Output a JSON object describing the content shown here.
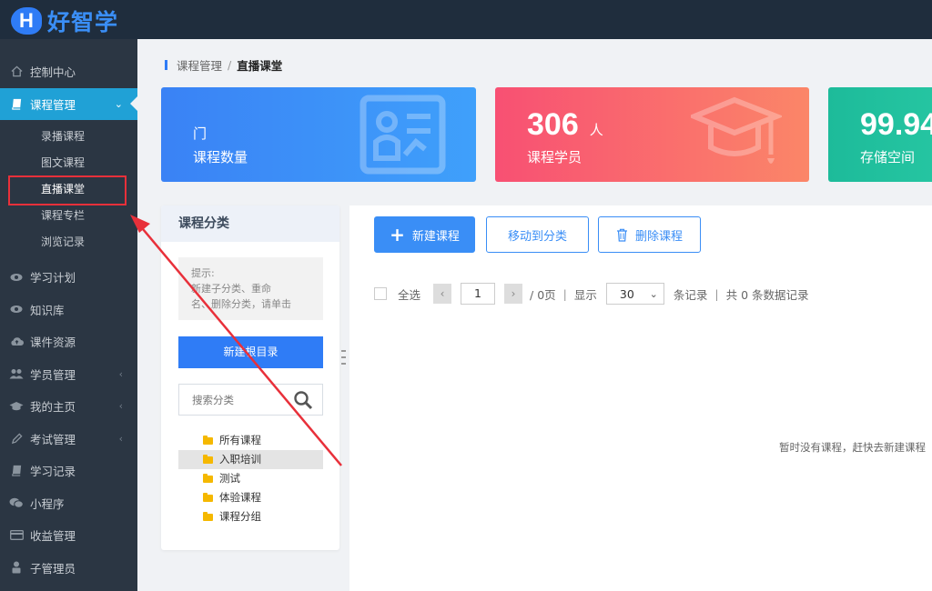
{
  "app": {
    "logo_letter": "H",
    "name": "好智学"
  },
  "sidebar": {
    "items": [
      {
        "label": "控制中心",
        "icon": "home-icon"
      },
      {
        "label": "课程管理",
        "icon": "book-icon",
        "active": true
      },
      {
        "label": "学习计划",
        "icon": "eye-icon"
      },
      {
        "label": "知识库",
        "icon": "eye-icon"
      },
      {
        "label": "课件资源",
        "icon": "cloud-upload-icon"
      },
      {
        "label": "学员管理",
        "icon": "users-icon"
      },
      {
        "label": "我的主页",
        "icon": "graduation-cap-icon"
      },
      {
        "label": "考试管理",
        "icon": "pen-icon"
      },
      {
        "label": "学习记录",
        "icon": "book-icon"
      },
      {
        "label": "小程序",
        "icon": "chat-icon"
      },
      {
        "label": "收益管理",
        "icon": "card-icon"
      },
      {
        "label": "子管理员",
        "icon": "user-lock-icon"
      }
    ],
    "sub_items": [
      "录播课程",
      "图文课程",
      "直播课堂",
      "课程专栏",
      "浏览记录"
    ]
  },
  "breadcrumb": {
    "parent": "课程管理",
    "separator": "/",
    "current": "直播课堂"
  },
  "stats": [
    {
      "value": "门",
      "unit": "",
      "label": "课程数量",
      "icon": "certificate-icon"
    },
    {
      "value": "306",
      "unit": "人",
      "label": "课程学员",
      "icon": "graduation-cap-icon"
    },
    {
      "value": "99.94",
      "unit": "",
      "label": "存储空间",
      "icon": "storage-icon"
    }
  ],
  "category": {
    "title": "课程分类",
    "tip": "提示:\n新建子分类、重命名、删除分类，请单击",
    "tip_line1": "提示:",
    "tip_line2": "新建子分类、重命",
    "tip_line3": "名、删除分类，请单击",
    "new_button": "新建根目录",
    "search_placeholder": "搜索分类",
    "tree": [
      "所有课程",
      "入职培训",
      "测试",
      "体验课程",
      "课程分组"
    ],
    "selected_index": 1
  },
  "toolbar": {
    "new_label": "新建课程",
    "move_label": "移动到分类",
    "delete_label": "删除课程"
  },
  "pager": {
    "select_all": "全选",
    "prev": "‹",
    "next": "›",
    "page": "1",
    "total_pages": "/ 0页",
    "show": "显示",
    "per_page": "30",
    "records_suffix": "条记录",
    "total": "共 0 条数据记录"
  },
  "empty_message": "暂时没有课程，赶快去新建课程",
  "colors": {
    "accent": "#2f7cf6",
    "sidebar_bg": "#2b3643",
    "topbar_bg": "#1f2d3d",
    "active_nav": "#20a1d6",
    "annotation": "#e8303a"
  }
}
